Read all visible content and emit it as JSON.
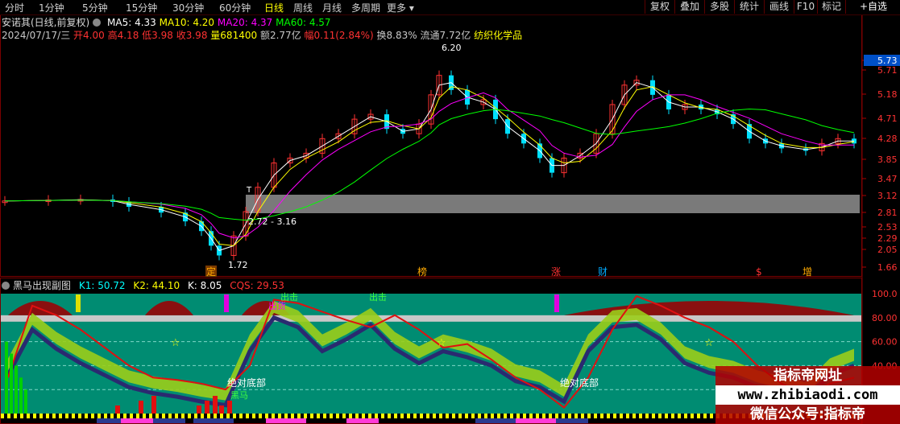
{
  "toolbar": {
    "periods": [
      "分时",
      "1分钟",
      "5分钟",
      "15分钟",
      "30分钟",
      "60分钟",
      "日线",
      "周线",
      "月线",
      "多周期",
      "更多"
    ],
    "active_period": "日线",
    "buttons": [
      "复权",
      "叠加",
      "多股",
      "统计",
      "画线",
      "F10",
      "标记",
      "+自选"
    ]
  },
  "header": {
    "stock": "安诺其(日线,前复权)",
    "ma5": "MA5: 4.33",
    "ma10": "MA10: 4.20",
    "ma20": "MA20: 4.37",
    "ma60": "MA60: 4.57"
  },
  "quote": {
    "date": "2024/07/17/三",
    "open": "开4.00",
    "high": "高4.18",
    "low": "低3.98",
    "close": "收3.98",
    "volume": "量681400",
    "amount": "额2.77亿",
    "change": "幅0.11(2.84%)",
    "turnover": "换8.83%",
    "float": "流通7.72亿",
    "industry": "纺织化学品"
  },
  "price_axis": [
    "5.73",
    "5.71",
    "5.18",
    "4.71",
    "4.28",
    "3.85",
    "3.47",
    "3.12",
    "2.81",
    "2.53",
    "2.29",
    "2.05",
    "1.66"
  ],
  "indicator_axis": [
    "100.0",
    "80.00",
    "60.00",
    "40.00"
  ],
  "annotations": {
    "high": "6.20",
    "low": "1.72",
    "gap": "2.72 - 3.16",
    "t_mark": "T",
    "events": [
      "定",
      "榜",
      "涨",
      "财",
      "$",
      "增"
    ]
  },
  "subchart": {
    "title": "黑马出现副图",
    "k1": "K1: 50.72",
    "k2": "K2: 44.10",
    "k": "K: 8.05",
    "cqs": "CQS: 29.53",
    "labels": [
      "绝对底部",
      "绝对底部",
      "出货",
      "出击",
      "出击",
      "黑马"
    ]
  },
  "watermark": {
    "line1": "指标帝网址",
    "line2": "www.zhibiaodi.com",
    "line3": "微信公众号:指标帝"
  },
  "colors": {
    "up": "#ff3232",
    "down": "#00e0ff",
    "ma5": "#ffffff",
    "ma10": "#ffff00",
    "ma20": "#ff00ff",
    "ma60": "#00ff00",
    "teal": "#008c72"
  }
}
